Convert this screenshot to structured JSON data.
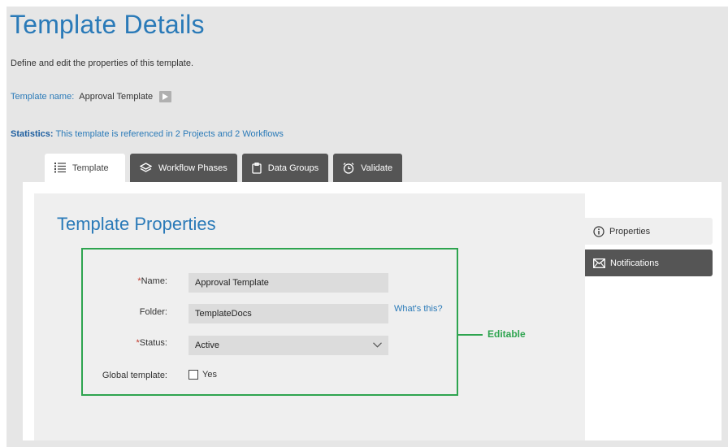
{
  "header": {
    "title": "Template Details",
    "subtitle": "Define and edit the properties of this template.",
    "template_name_label": "Template name:",
    "template_name_value": "Approval Template",
    "statistics_label": "Statistics:",
    "statistics_text": "This template is referenced in 2 Projects and 2 Workflows"
  },
  "tabs": [
    {
      "label": "Template",
      "icon": "list-icon",
      "active": true
    },
    {
      "label": "Workflow Phases",
      "icon": "layers-icon",
      "active": false
    },
    {
      "label": "Data Groups",
      "icon": "document-icon",
      "active": false
    },
    {
      "label": "Validate",
      "icon": "alarm-clock-icon",
      "active": false
    }
  ],
  "section": {
    "title": "Template Properties"
  },
  "form": {
    "name_required": "*",
    "name_label": "Name:",
    "name_value": "Approval Template",
    "folder_label": "Folder:",
    "folder_value": "TemplateDocs",
    "folder_help": "What's this?",
    "status_required": "*",
    "status_label": "Status:",
    "status_value": "Active",
    "global_label": "Global template:",
    "global_checkbox_label": "Yes",
    "global_checked": false
  },
  "callout": {
    "text": "Editable",
    "color": "#2ea44f"
  },
  "side_nav": [
    {
      "label": "Properties",
      "icon": "info-icon",
      "active": false
    },
    {
      "label": "Notifications",
      "icon": "envelope-icon",
      "active": true
    }
  ],
  "colors": {
    "accent": "#2a7ab8",
    "tab_dark": "#555555",
    "required": "#c0392b"
  }
}
